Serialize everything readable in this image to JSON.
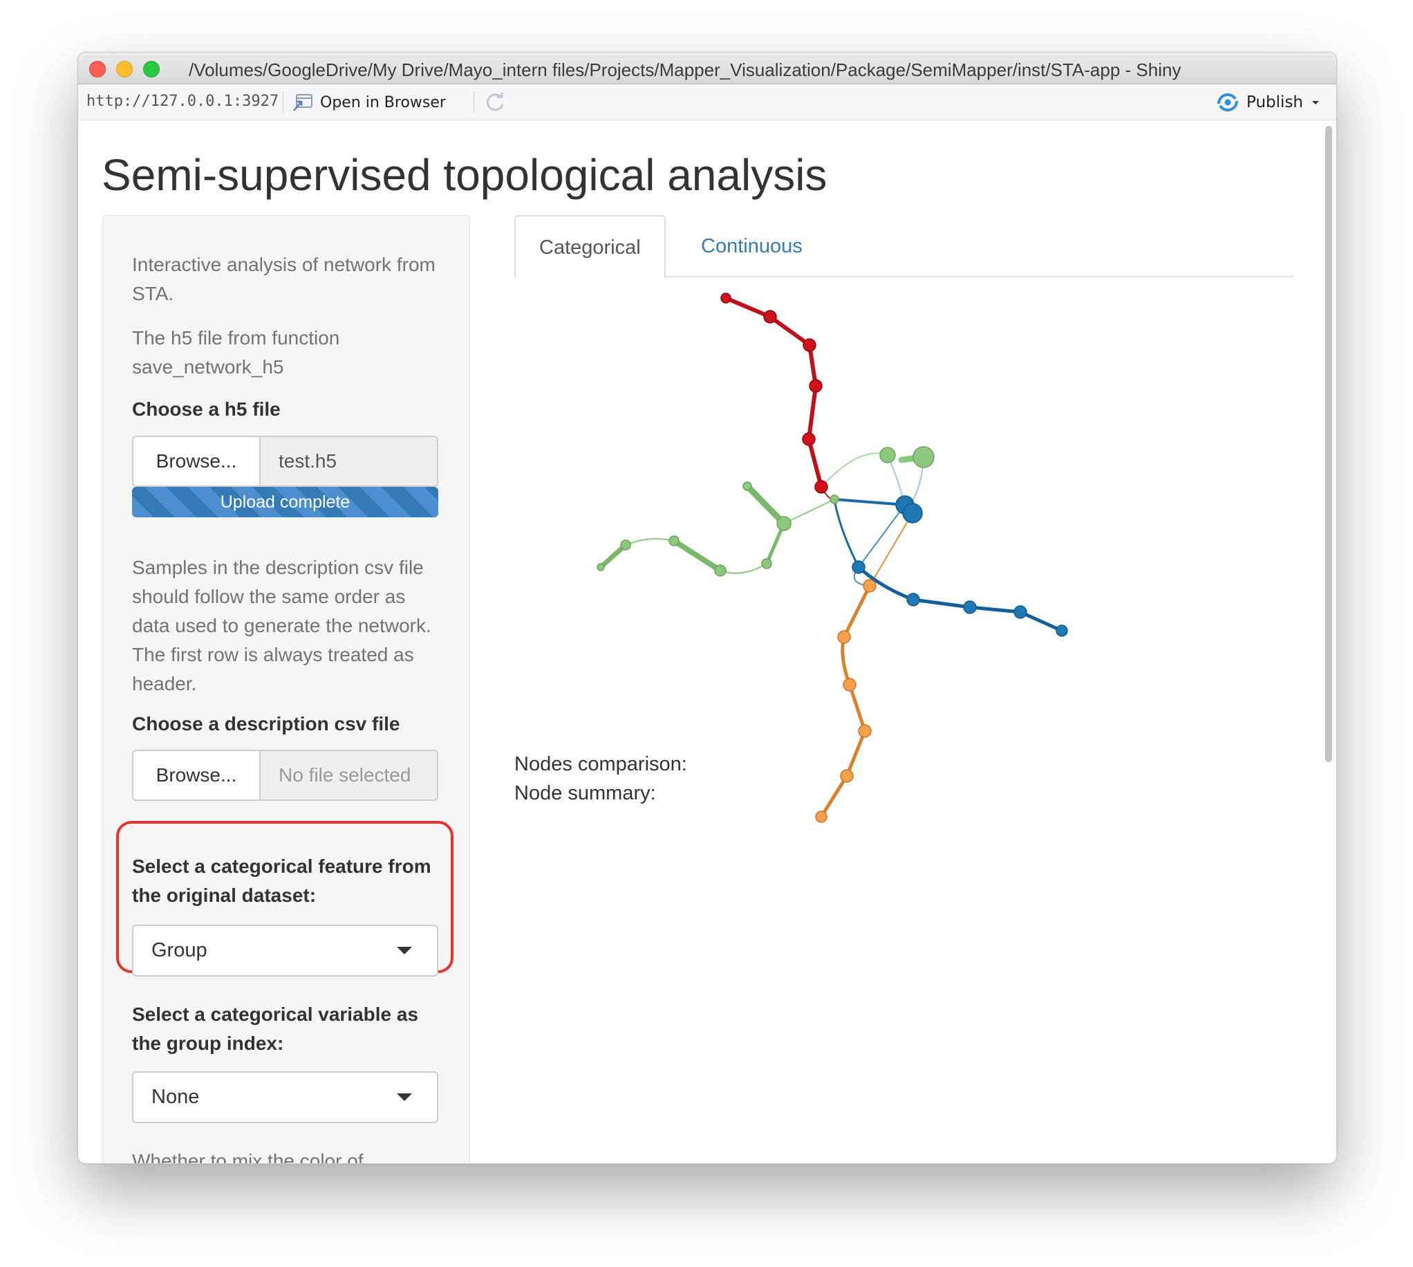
{
  "window": {
    "title": "/Volumes/GoogleDrive/My Drive/Mayo_intern files/Projects/Mapper_Visualization/Package/SemiMapper/inst/STA-app - Shiny"
  },
  "toolbar": {
    "url": "http://127.0.0.1:3927",
    "open_in_browser": "Open in Browser",
    "publish": "Publish"
  },
  "page": {
    "title": "Semi-supervised topological analysis"
  },
  "sidebar": {
    "intro": "Interactive analysis of network from STA.",
    "h5_help": "The h5 file from function save_network_h5",
    "h5_label": "Choose a h5 file",
    "h5_browse": "Browse...",
    "h5_filename": "test.h5",
    "upload_status": "Upload complete",
    "upload_progress": 1.0,
    "csv_help": "Samples in the description csv file should follow the same order as data used to generate the network. The first row is always treated as header.",
    "csv_label": "Choose a description csv file",
    "csv_browse": "Browse...",
    "csv_placeholder": "No file selected",
    "feature_label": "Select a categorical feature from the original dataset:",
    "feature_value": "Group",
    "group_label": "Select a categorical variable as the group index:",
    "group_value": "None",
    "mix_label": "Whether to mix the color of"
  },
  "tabs": [
    "Categorical",
    "Continuous"
  ],
  "output": {
    "nodes_comparison": "Nodes comparison:",
    "node_summary": "Node summary:"
  },
  "colors": {
    "accent": "#337ab7",
    "highlight": "#e8332c",
    "red_branch": "#d0101a",
    "green_branch": "#8cc87e",
    "blue_branch": "#1f77b4",
    "orange_branch": "#f5a04c"
  },
  "icons": {
    "open_in_browser": "browser-window-icon",
    "refresh": "refresh-icon",
    "publish": "publish-icon"
  }
}
